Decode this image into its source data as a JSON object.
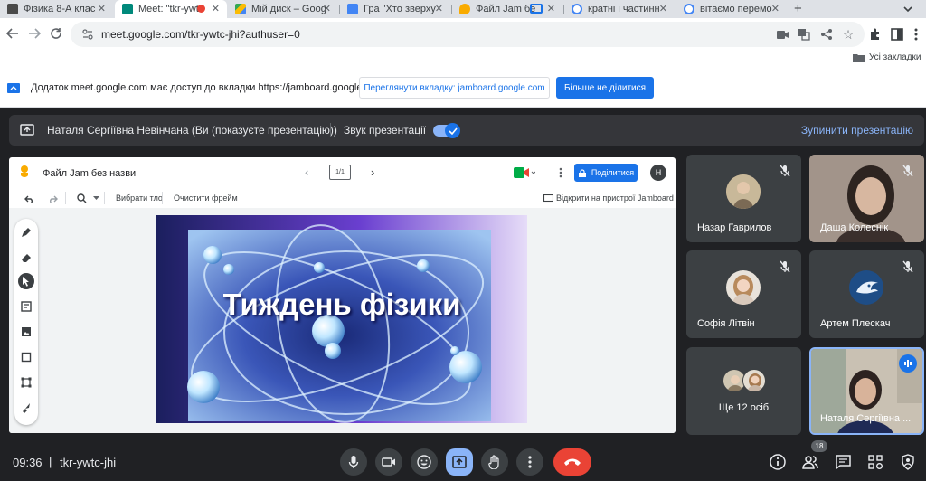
{
  "browser": {
    "tabs": [
      {
        "label": "Фізика 8-А клас",
        "favicon": "#4a4a4a"
      },
      {
        "label": "Meet: \"tkr-ywt",
        "favicon": "#00897b",
        "active": true
      },
      {
        "label": "Мій диск – Goog",
        "favicon": "#fbbc04"
      },
      {
        "label": "Гра \"Хто зверху",
        "favicon": "#4285f4"
      },
      {
        "label": "Файл Jam бе",
        "favicon": "#f9ab00"
      },
      {
        "label": "кратні і частинн",
        "favicon": "#4285f4"
      },
      {
        "label": "вітаємо перемо",
        "favicon": "#4285f4"
      }
    ],
    "new_tab": "+",
    "url": "meet.google.com/tkr-ywtc-jhi?authuser=0",
    "bookmarks_label": "Усі закладки"
  },
  "infobar": {
    "message": "Додаток meet.google.com має доступ до вкладки https://jamboard.google.com",
    "view_tab_button": "Переглянути вкладку: jamboard.google.com",
    "stop_sharing_button": "Більше не ділитися"
  },
  "present_bar": {
    "presenter": "Наталя Сергіївна Невінчана (Ви (показуєте презентацію))",
    "sound_label": "Звук презентації",
    "stop_label": "Зупинити презентацію"
  },
  "jamboard": {
    "title": "Файл Jam без назви",
    "frame_counter": "1/1",
    "share_button": "Поділитися",
    "user_initial": "Н",
    "select_background": "Вибрати тло",
    "clear_frame": "Очистити фрейм",
    "open_on_device": "Відкрити на пристрої Jamboard",
    "slide_text": "Тиждень фізики"
  },
  "participants": [
    {
      "name": "Назар Гаврилов",
      "muted": true
    },
    {
      "name": "Даша Колеснік",
      "muted": true
    },
    {
      "name": "Софія Літвін",
      "muted": true
    },
    {
      "name": "Артем Плескач",
      "muted": true
    },
    {
      "name": "Ще 12 осіб"
    },
    {
      "name": "Наталя Сергіївна ..."
    }
  ],
  "bottom": {
    "time": "09:36",
    "separator": "|",
    "meeting_code": "tkr-ywtc-jhi",
    "participant_count": "18"
  }
}
